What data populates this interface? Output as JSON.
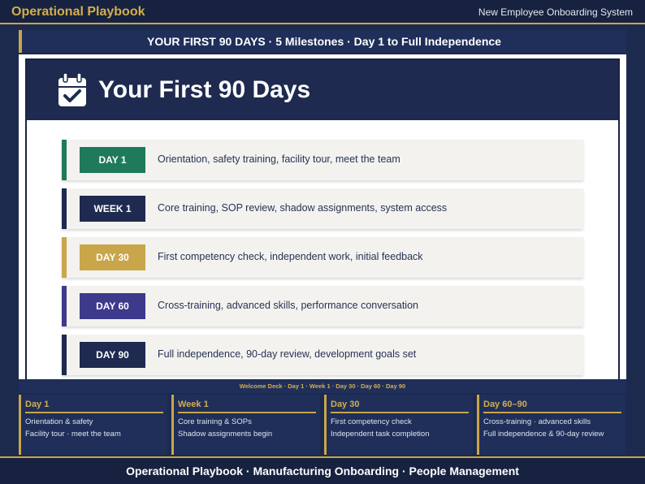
{
  "topbar": {
    "brand": "Operational Playbook",
    "system": "New Employee Onboarding System"
  },
  "banner": {
    "text": "YOUR FIRST 90 DAYS  ·  5 Milestones  ·  Day 1 to Full Independence"
  },
  "slide": {
    "title": "Your First 90 Days",
    "icon": "calendar-check-icon",
    "milestones": [
      {
        "label": "DAY 1",
        "text": "Orientation, safety training, facility tour, meet the team",
        "color": "#1e7a5a"
      },
      {
        "label": "WEEK 1",
        "text": "Core training, SOP review, shadow assignments, system access",
        "color": "#1e2a4f"
      },
      {
        "label": "DAY 30",
        "text": "First competency check, independent work, initial feedback",
        "color": "#c9a64a"
      },
      {
        "label": "DAY 60",
        "text": "Cross-training, advanced skills, performance conversation",
        "color": "#3d3a8c"
      },
      {
        "label": "DAY 90",
        "text": "Full independence, 90-day review, development goals set",
        "color": "#1e2a4f"
      }
    ]
  },
  "caption": "Welcome Deck · Day 1 · Week 1 · Day 30 · Day 60 · Day 90",
  "cards": [
    {
      "title": "Day 1",
      "lines": [
        "Orientation & safety",
        "Facility tour · meet the team"
      ]
    },
    {
      "title": "Week 1",
      "lines": [
        "Core training & SOPs",
        "Shadow assignments begin"
      ]
    },
    {
      "title": "Day 30",
      "lines": [
        "First competency check",
        "Independent task completion"
      ]
    },
    {
      "title": "Day 60–90",
      "lines": [
        "Cross-training · advanced skills",
        "Full independence & 90-day review"
      ]
    }
  ],
  "footer": "Operational Playbook  ·  Manufacturing Onboarding  ·  People Management",
  "colors": {
    "navy": "#1e2a4f",
    "gold": "#c9a64a",
    "green": "#1e7a5a",
    "purple": "#3d3a8c"
  }
}
